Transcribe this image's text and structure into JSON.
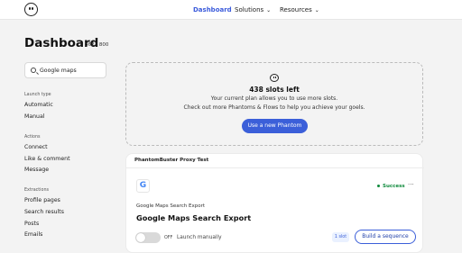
{
  "nav": {
    "dashboard": "Dashboard",
    "solutions": "Solutions",
    "resources": "Resources",
    "chevron": "⌄",
    "active_color": "#3b5bdb"
  },
  "header": {
    "title": "Dashboard",
    "count": "362 / 800"
  },
  "search": {
    "value": "Google maps",
    "icon": "search-icon"
  },
  "sidebar": {
    "launch_type": {
      "title": "Launch type",
      "items": [
        "Automatic",
        "Manual"
      ]
    },
    "actions": {
      "title": "Actions",
      "items": [
        "Connect",
        "Like & comment",
        "Message"
      ]
    },
    "extractions": {
      "title": "Extractions",
      "items": [
        "Profile pages",
        "Search results",
        "Posts",
        "Emails"
      ]
    }
  },
  "slots": {
    "title": "438 slots left",
    "line1": "Your current plan allows you to use more slots.",
    "line2": "Check out more Phantoms & Flows to help you achieve your goels.",
    "button": "Use a new Phantom"
  },
  "card": {
    "header_title": "PhantomBuster Proxy Test",
    "header_menu": "···",
    "logo_letter": "G",
    "status": "Success",
    "status_color": "#0f8a3c",
    "more": "···",
    "subtitle": "Google Maps Search Export",
    "title": "Google Maps Search Export",
    "toggle_state": "OFF",
    "launch": "Launch manually",
    "slot": "1 slot",
    "button": "Build a sequence"
  },
  "brand_color": "#3b5fd9"
}
